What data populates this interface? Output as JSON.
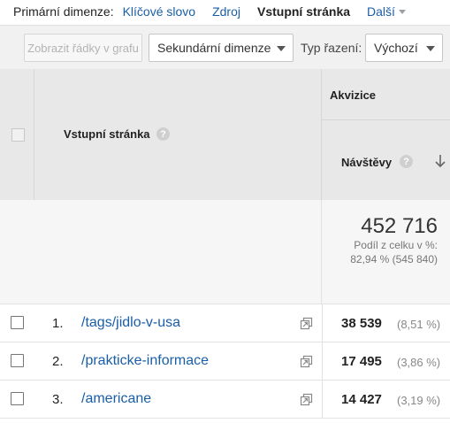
{
  "primary_dimension": {
    "label": "Primární dimenze:",
    "options": [
      "Klíčové slovo",
      "Zdroj"
    ],
    "active": "Vstupní stránka",
    "more": "Další"
  },
  "toolbar": {
    "plot_rows_label": "Zobrazit řádky v grafu",
    "secondary_dimension_label": "Sekundární dimenze",
    "sort_type_label": "Typ řazení:",
    "sort_type_value": "Výchozí"
  },
  "table": {
    "dimension_header": "Vstupní stránka",
    "group_header": "Akvizice",
    "metric_header": "Návštěvy",
    "totals": {
      "value": "452 716",
      "percent_label": "Podíl z celku v %:",
      "percent_value": "82,94 % (545 840)"
    },
    "rows": [
      {
        "index": "1.",
        "page": "/tags/jidlo-v-usa",
        "visits": "38 539",
        "percent": "(8,51 %)"
      },
      {
        "index": "2.",
        "page": "/prakticke-informace",
        "visits": "17 495",
        "percent": "(3,86 %)"
      },
      {
        "index": "3.",
        "page": "/americane",
        "visits": "14 427",
        "percent": "(3,19 %)"
      }
    ]
  },
  "colors": {
    "link": "#1a5ea8",
    "header_bg": "#e8e8e8",
    "toolbar_bg": "#f1f1f1"
  }
}
